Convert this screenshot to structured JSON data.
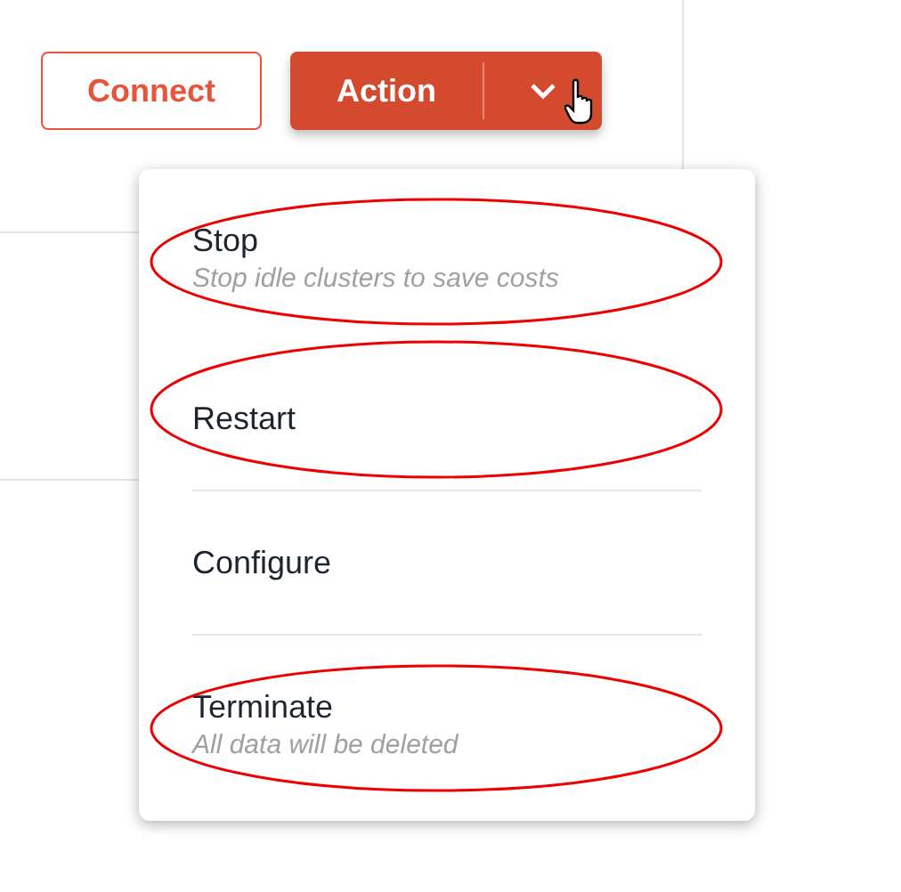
{
  "toolbar": {
    "buttons": [
      {
        "kind": "outline",
        "label": "Connect"
      },
      {
        "kind": "split",
        "label": "Action"
      }
    ]
  },
  "menu": {
    "items": [
      {
        "label": "Stop",
        "description": "Stop idle clusters to save costs",
        "highlighted": true,
        "divider_before": false
      },
      {
        "label": "Restart",
        "highlighted": true,
        "divider_before": false
      },
      {
        "label": "Configure",
        "highlighted": false,
        "divider_before": true
      },
      {
        "label": "Terminate",
        "description": "All data will be deleted",
        "highlighted": true,
        "divider_before": true
      }
    ]
  }
}
